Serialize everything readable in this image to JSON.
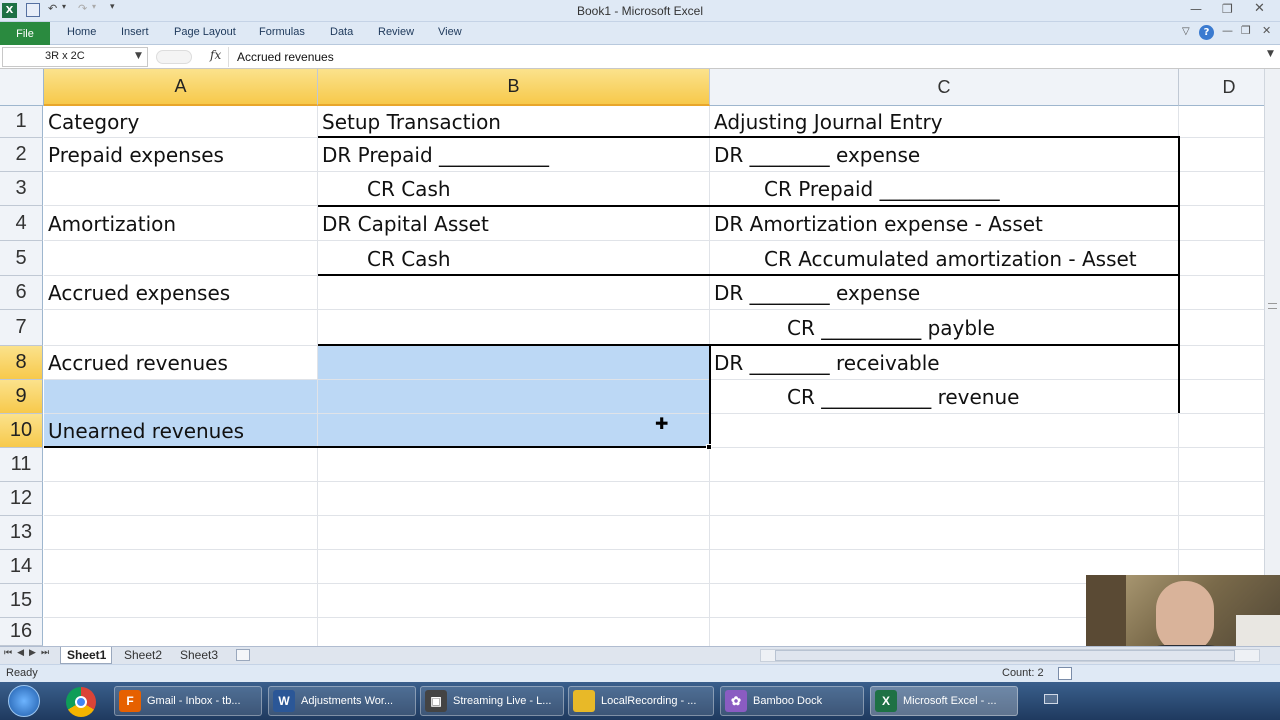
{
  "window": {
    "title": "Book1 - Microsoft Excel"
  },
  "ribbon": {
    "tabs": [
      "File",
      "Home",
      "Insert",
      "Page Layout",
      "Formulas",
      "Data",
      "Review",
      "View"
    ]
  },
  "formula_bar": {
    "name_box": "3R x 2C",
    "fx": "fx",
    "content": "Accrued revenues"
  },
  "columns": [
    "A",
    "B",
    "C",
    "D"
  ],
  "rows": [
    "1",
    "2",
    "3",
    "4",
    "5",
    "6",
    "7",
    "8",
    "9",
    "10",
    "11",
    "12",
    "13",
    "14",
    "15",
    "16"
  ],
  "cells": {
    "A1": "Category",
    "B1": "Setup Transaction",
    "C1": "Adjusting Journal Entry",
    "A2": "Prepaid expenses",
    "B2": "DR Prepaid ___________",
    "C2": "DR ________ expense",
    "B3": "CR Cash",
    "C3": "CR Prepaid ____________",
    "A4": "Amortization",
    "B4": "DR Capital Asset",
    "C4": "DR Amortization expense - Asset",
    "B5": "CR Cash",
    "C5": "CR Accumulated amortization - Asset",
    "A6": "Accrued expenses",
    "C6": "DR ________ expense",
    "C7": "CR __________ payble",
    "A8": "Accrued revenues",
    "C8": "DR ________ receivable",
    "C9": "CR ___________ revenue",
    "A10": "Unearned revenues"
  },
  "sheet_tabs": [
    "Sheet1",
    "Sheet2",
    "Sheet3"
  ],
  "status": {
    "ready": "Ready",
    "count": "Count: 2"
  },
  "taskbar": [
    {
      "label": "Gmail - Inbox - tb...",
      "icon": "firefox-icon",
      "color": "#e66000"
    },
    {
      "label": "Adjustments Wor...",
      "icon": "word-icon",
      "color": "#2b5797"
    },
    {
      "label": "Streaming Live - L...",
      "icon": "streaming-icon",
      "color": "#444"
    },
    {
      "label": "LocalRecording - ...",
      "icon": "folder-icon",
      "color": "#e8b928"
    },
    {
      "label": "Bamboo Dock",
      "icon": "bamboo-icon",
      "color": "#8a5cc2"
    },
    {
      "label": "Microsoft Excel - ...",
      "icon": "excel-icon",
      "color": "#1e7145"
    }
  ],
  "colors": {
    "selection": "#bcd8f5",
    "header_selected": "#f7c94b",
    "excel_green": "#1e7145"
  }
}
